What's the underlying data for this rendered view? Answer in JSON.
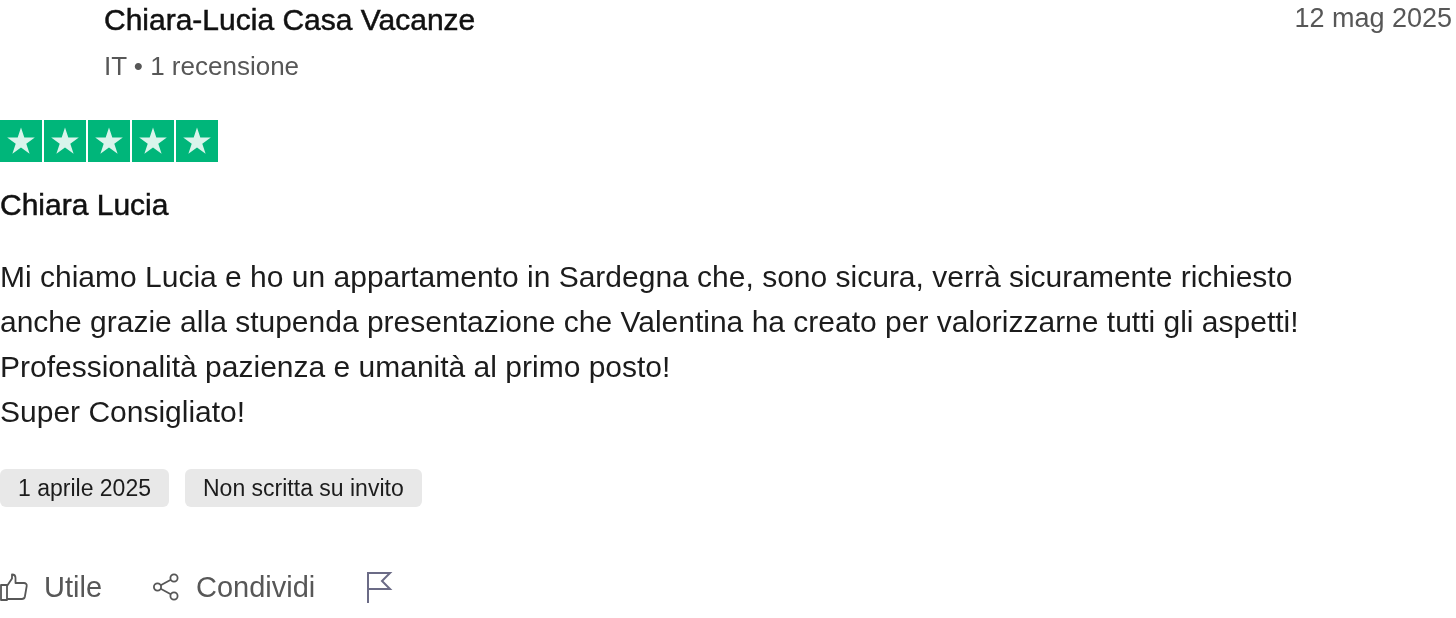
{
  "reviewer": {
    "name": "Chiara-Lucia Casa Vacanze",
    "meta": "IT • 1 recensione"
  },
  "date": "12 mag 2025",
  "rating": {
    "stars": 5
  },
  "title": "Chiara Lucia",
  "body": "Mi chiamo Lucia e ho un appartamento in Sardegna che, sono sicura, verrà sicuramente richiesto anche grazie alla stupenda presentazione che Valentina ha creato per valorizzarne tutti gli aspetti!\nProfessionalità pazienza e umanità al primo posto!\nSuper Consigliato!",
  "tags": [
    "1 aprile 2025",
    "Non scritta su invito"
  ],
  "actions": [
    {
      "kind": "like",
      "label": "Utile"
    },
    {
      "kind": "share",
      "label": "Condividi"
    },
    {
      "kind": "report"
    }
  ]
}
